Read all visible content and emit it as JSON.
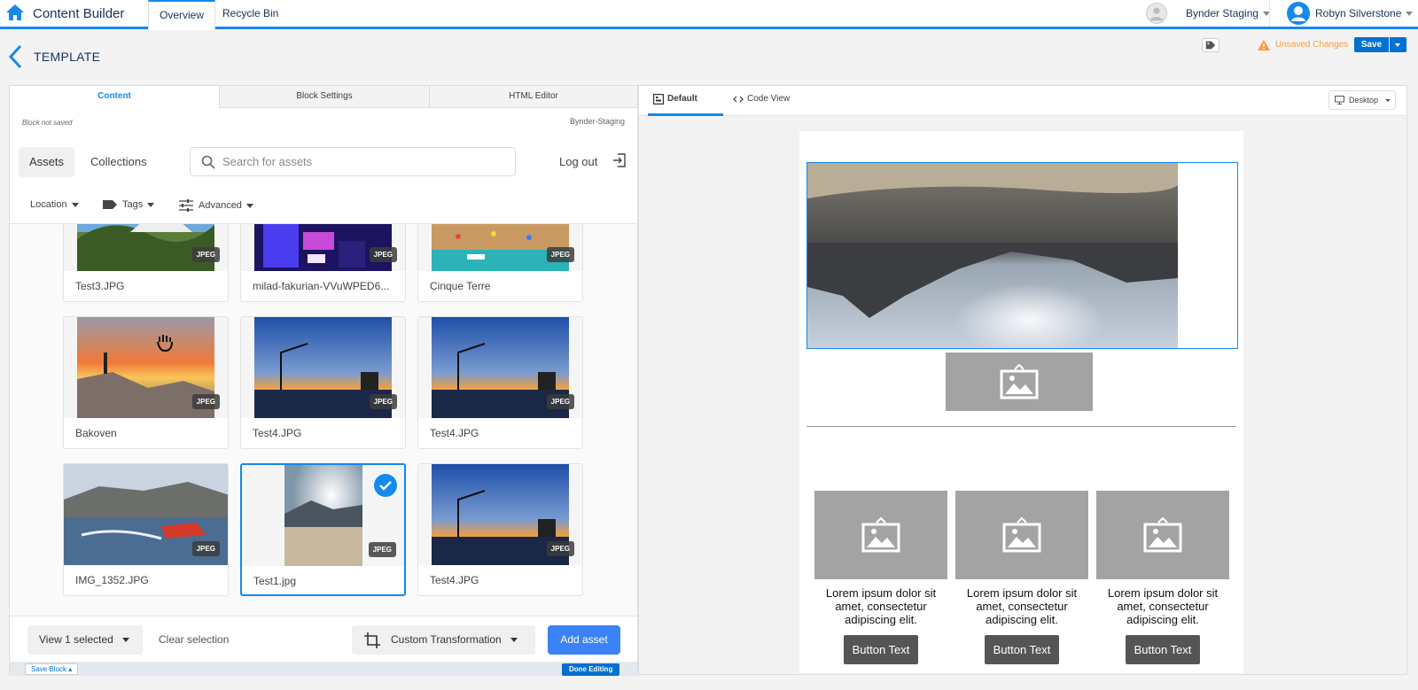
{
  "app": {
    "title": "Content Builder"
  },
  "top_tabs": [
    {
      "label": "Overview"
    },
    {
      "label": "Recycle Bin"
    }
  ],
  "top_right": {
    "business_unit": "Bynder Staging",
    "user_name": "Robyn Silverstone"
  },
  "header": {
    "title": "TEMPLATE",
    "unsaved": "Unsaved Changes",
    "save_label": "Save"
  },
  "editor_tabs": [
    {
      "label": "Content"
    },
    {
      "label": "Block Settings"
    },
    {
      "label": "HTML Editor"
    }
  ],
  "block_status": "Block not saved",
  "connection_label": "Bynder-Staging",
  "asset_nav": {
    "assets": "Assets",
    "collections": "Collections"
  },
  "search": {
    "placeholder": "Search for assets",
    "value": ""
  },
  "logout": "Log out",
  "filters": [
    {
      "label": "Location",
      "icon": "none"
    },
    {
      "label": "Tags",
      "icon": "tag-icon"
    },
    {
      "label": "Advanced",
      "icon": "sliders-icon"
    }
  ],
  "assets": [
    {
      "name": "Test3.JPG",
      "badge": "JPEG"
    },
    {
      "name": "milad-fakurian-VVuWPED6...",
      "badge": "JPEG"
    },
    {
      "name": "Cinque Terre",
      "badge": "JPEG"
    },
    {
      "name": "Bakoven",
      "badge": "JPEG"
    },
    {
      "name": "Test4.JPG",
      "badge": "JPEG"
    },
    {
      "name": "Test4.JPG",
      "badge": "JPEG"
    },
    {
      "name": "IMG_1352.JPG",
      "badge": "JPEG"
    },
    {
      "name": "Test1.jpg",
      "badge": "JPEG",
      "selected": true
    },
    {
      "name": "Test4.JPG",
      "badge": "JPEG"
    }
  ],
  "actions": {
    "view_selected": "View 1 selected",
    "clear_selection": "Clear selection",
    "custom_transformation": "Custom Transformation",
    "add_asset": "Add asset"
  },
  "footer": {
    "save_block": "Save Block",
    "done_editing": "Done Editing"
  },
  "preview": {
    "tabs": [
      {
        "label": "Default"
      },
      {
        "label": "Code View"
      }
    ],
    "device": "Desktop",
    "columns": [
      {
        "text": "Lorem ipsum dolor sit amet, consectetur adipiscing elit.",
        "button": "Button Text"
      },
      {
        "text": "Lorem ipsum dolor sit amet, consectetur adipiscing elit.",
        "button": "Button Text"
      },
      {
        "text": "Lorem ipsum dolor sit amet, consectetur adipiscing elit.",
        "button": "Button Text"
      }
    ]
  },
  "colors": {
    "accent": "#1589ee",
    "save_blue": "#0070d2",
    "add_asset_blue": "#3b82f6",
    "unsaved_orange": "#ff9a3c",
    "placeholder_gray": "#a3a3a3"
  }
}
